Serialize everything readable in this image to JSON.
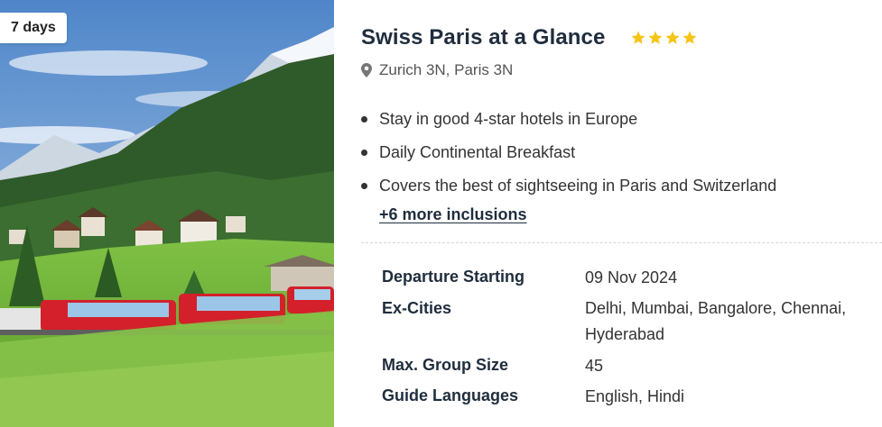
{
  "package": {
    "duration_badge": "7 days",
    "title": "Swiss Paris at a Glance",
    "star_rating": 4,
    "star_color": "#f5c518",
    "location_icon": "map-pin-icon",
    "location": "Zurich 3N, Paris 3N",
    "inclusions": [
      "Stay in good 4-star hotels in Europe",
      "Daily Continental Breakfast",
      "Covers the best of sightseeing in Paris and Switzerland"
    ],
    "more_inclusions_link": "+6 more inclusions"
  },
  "details": {
    "departure_label": "Departure Starting",
    "departure_value": "09 Nov 2024",
    "ex_cities_label": "Ex-Cities",
    "ex_cities_line1": "Delhi, Mumbai, Bangalore, Chennai,",
    "ex_cities_line2": "Hyderabad",
    "group_size_label": "Max. Group Size",
    "group_size_value": "45",
    "guide_languages_label": "Guide Languages",
    "guide_languages_value": "English, Hindi"
  },
  "colors": {
    "heading": "#1f2d3d",
    "train_red": "#d3202a"
  }
}
